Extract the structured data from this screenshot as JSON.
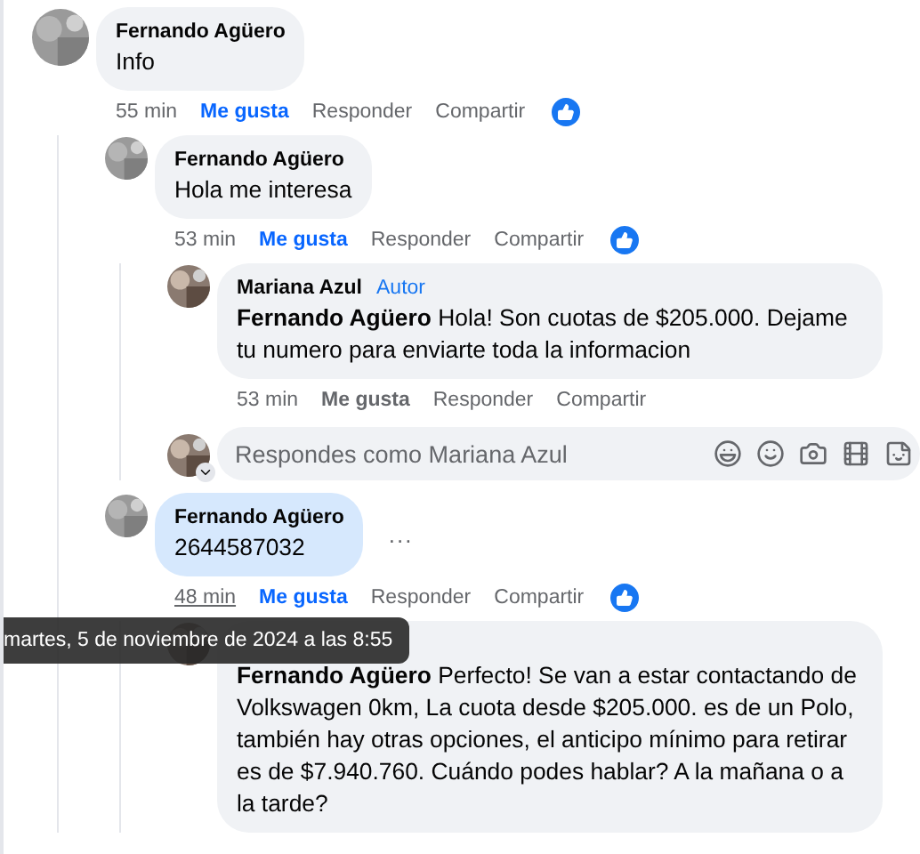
{
  "comments": [
    {
      "author": "Fernando Agüero",
      "text": "Info",
      "time": "55 min",
      "time_hovered": false,
      "like_label": "Me gusta",
      "liked": true,
      "reply_label": "Responder",
      "share_label": "Compartir",
      "reaction": true,
      "highlighted": false,
      "children": [
        {
          "author": "Fernando Agüero",
          "text": "Hola me interesa",
          "time": "53 min",
          "time_hovered": false,
          "like_label": "Me gusta",
          "liked": true,
          "reply_label": "Responder",
          "share_label": "Compartir",
          "reaction": true,
          "highlighted": false,
          "children": [
            {
              "author": "Mariana Azul",
              "badge": "Autor",
              "text": "**Fernando Agüero** Hola! Son cuotas de $205.000. Dejame tu numero para enviarte toda la informacion",
              "time": "53 min",
              "time_hovered": false,
              "like_label": "Me gusta",
              "liked": false,
              "reply_label": "Responder",
              "share_label": "Compartir",
              "reaction": false,
              "highlighted": false
            }
          ],
          "reply_box": {
            "placeholder": "Respondes como Mariana Azul"
          }
        },
        {
          "author": "Fernando Agüero",
          "text": "2644587032",
          "more": "...",
          "time": "48 min",
          "time_hovered": true,
          "like_label": "Me gusta",
          "liked": true,
          "reply_label": "Responder",
          "share_label": "Compartir",
          "reaction": true,
          "highlighted": true,
          "tooltip": "martes, 5 de noviembre de 2024 a las 8:55",
          "children": [
            {
              "text": "**Fernando Agüero** Perfecto! Se van a estar contactando de Volkswagen 0km, La cuota desde $205.000. es de un Polo, también hay otras opciones, el anticipo mínimo para retirar es de $7.940.760. Cuándo podes hablar? A la mañana o a la tarde?",
              "highlighted": false
            }
          ]
        }
      ]
    }
  ]
}
